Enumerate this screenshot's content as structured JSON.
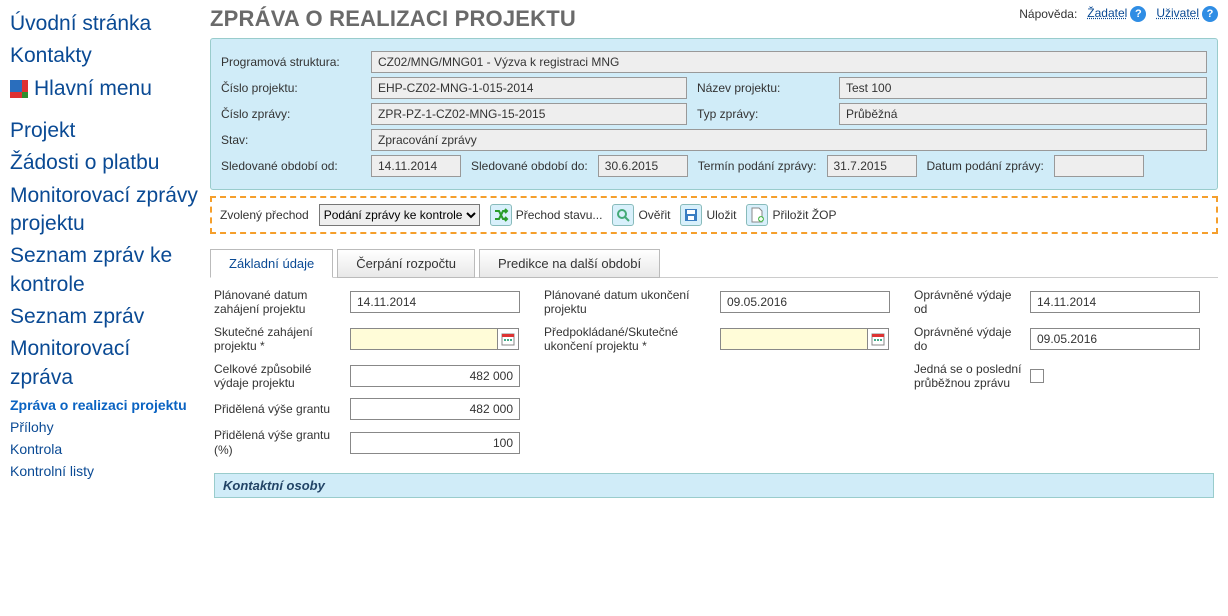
{
  "sidebar": {
    "home": "Úvodní stránka",
    "contacts": "Kontakty",
    "mainmenu": "Hlavní menu",
    "project": "Projekt",
    "paymentreq": "Žádosti o platbu",
    "monreports": "Monitorovací zprávy projektu",
    "checklist": "Seznam zpráv ke kontrole",
    "reportlist": "Seznam zpráv",
    "monreport": "Monitorovací zpráva",
    "sub_realreport": "Zpráva o realizaci projektu",
    "sub_attach": "Přílohy",
    "sub_control": "Kontrola",
    "sub_checklists": "Kontrolní listy"
  },
  "header": {
    "title": "Zpráva o realizaci projektu",
    "help_label": "Nápověda:",
    "help_applicant": "Žadatel",
    "help_user": "Uživatel"
  },
  "info": {
    "prog_struct_lbl": "Programová struktura:",
    "prog_struct_val": "CZ02/MNG/MNG01 - Výzva k registraci MNG",
    "projnum_lbl": "Číslo projektu:",
    "projnum_val": "EHP-CZ02-MNG-1-015-2014",
    "projname_lbl": "Název projektu:",
    "projname_val": "Test 100",
    "repnum_lbl": "Číslo zprávy:",
    "repnum_val": "ZPR-PZ-1-CZ02-MNG-15-2015",
    "reptype_lbl": "Typ zprávy:",
    "reptype_val": "Průběžná",
    "state_lbl": "Stav:",
    "state_val": "Zpracování zprávy",
    "period_from_lbl": "Sledované období od:",
    "period_from_val": "14.11.2014",
    "period_to_lbl": "Sledované období do:",
    "period_to_val": "30.6.2015",
    "deadline_lbl": "Termín podání zprávy:",
    "deadline_val": "31.7.2015",
    "submitdate_lbl": "Datum podání zprávy:",
    "submitdate_val": ""
  },
  "toolbar": {
    "transition_lbl": "Zvolený přechod",
    "transition_sel": "Podání zprávy ke kontrole",
    "btn_transition": "Přechod stavu...",
    "btn_verify": "Ověřit",
    "btn_save": "Uložit",
    "btn_attach": "Přiložit ŽOP"
  },
  "tabs": {
    "t1": "Základní údaje",
    "t2": "Čerpání rozpočtu",
    "t3": "Predikce na další období"
  },
  "form": {
    "plan_start_lbl": "Plánované datum zahájení projektu",
    "plan_start_val": "14.11.2014",
    "plan_end_lbl": "Plánované datum ukončení projektu",
    "plan_end_val": "09.05.2016",
    "elig_from_lbl": "Oprávněné výdaje od",
    "elig_from_val": "14.11.2014",
    "real_start_lbl": "Skutečné zahájení projektu *",
    "real_start_val": "",
    "exp_end_lbl": "Předpokládané/Skutečné ukončení projektu *",
    "exp_end_val": "",
    "elig_to_lbl": "Oprávněné výdaje do",
    "elig_to_val": "09.05.2016",
    "total_elig_lbl": "Celkové způsobilé výdaje projektu",
    "total_elig_val": "482 000",
    "last_interim_lbl": "Jedná se o poslední průběžnou zprávu",
    "grant_amt_lbl": "Přidělená výše grantu",
    "grant_amt_val": "482 000",
    "grant_pct_lbl": "Přidělená výše grantu (%)",
    "grant_pct_val": "100"
  },
  "section": {
    "contacts": "Kontaktní osoby"
  }
}
